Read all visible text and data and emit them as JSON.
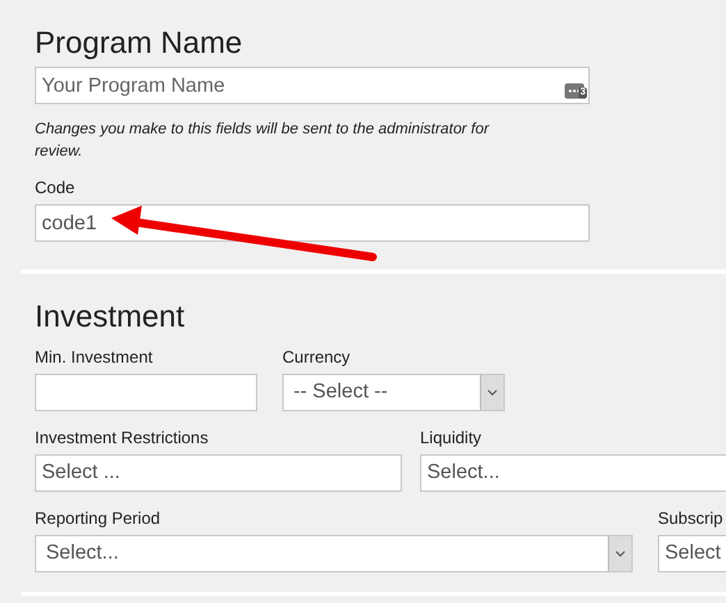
{
  "sections": [
    {
      "title": "Program Name",
      "rows": [
        {
          "kind": "fields",
          "fields": [
            {
              "kind": "text",
              "placeholder": "Your Program Name",
              "icon_badge": "3"
            }
          ]
        },
        {
          "kind": "note",
          "text": "Changes you make to this fields will be sent to the administrator for review."
        },
        {
          "kind": "fields",
          "fields": [
            {
              "kind": "text",
              "label": "Code",
              "value": "code1",
              "arrow": true
            }
          ]
        }
      ]
    },
    {
      "title": "Investment",
      "rows": [
        {
          "kind": "fields",
          "fields": [
            {
              "kind": "text",
              "label": "Min. Investment"
            },
            {
              "kind": "select",
              "label": "Currency",
              "value": "-- Select --"
            }
          ]
        },
        {
          "kind": "fields",
          "fields": [
            {
              "kind": "multi",
              "label": "Investment Restrictions",
              "placeholder": "Select ..."
            },
            {
              "kind": "multi",
              "label": "Liquidity",
              "placeholder": "Select..."
            }
          ]
        },
        {
          "kind": "fields",
          "fields": [
            {
              "kind": "select",
              "label": "Reporting Period",
              "value": "Select..."
            },
            {
              "kind": "multi",
              "label": "Subscrip",
              "placeholder": "Select"
            }
          ]
        }
      ]
    }
  ]
}
